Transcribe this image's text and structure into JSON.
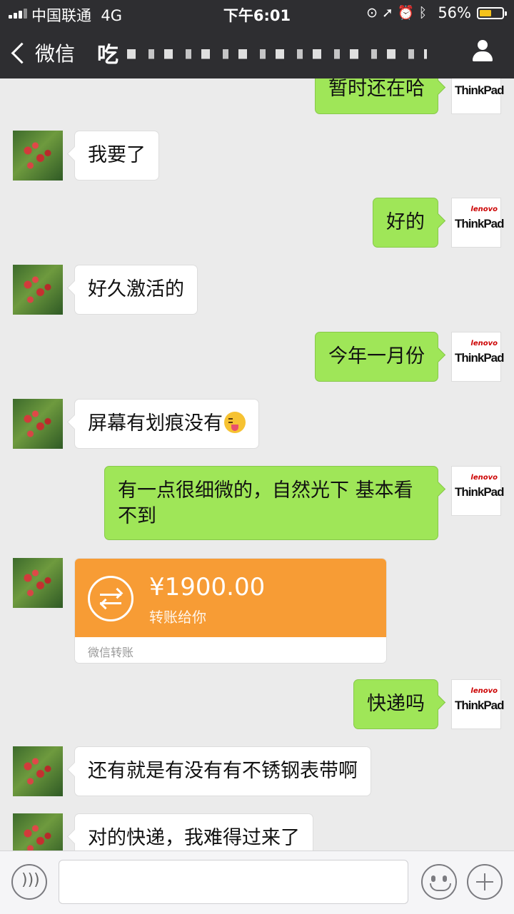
{
  "status_bar": {
    "carrier": "中国联通",
    "network": "4G",
    "time": "下午6:01",
    "battery_percent": "56%"
  },
  "nav": {
    "back_label": "微信",
    "title": "吃"
  },
  "messages": [
    {
      "side": "right",
      "text": "暂时还在哈"
    },
    {
      "side": "left",
      "text": "我要了"
    },
    {
      "side": "right",
      "text": "好的"
    },
    {
      "side": "left",
      "text": "好久激活的"
    },
    {
      "side": "right",
      "text": "今年一月份"
    },
    {
      "side": "left",
      "text": "屏幕有划痕没有",
      "emoji": "squinting-tongue-emoji"
    },
    {
      "side": "right",
      "text_line1": "有一点很细微的，自然光下 基本看",
      "text_line2": "不到"
    },
    {
      "side": "left",
      "type": "transfer",
      "amount": "¥1900.00",
      "desc": "转账给你",
      "label": "微信转账"
    },
    {
      "side": "right",
      "text": "快递吗"
    },
    {
      "side": "left",
      "text": "还有就是有没有有不锈钢表带啊"
    },
    {
      "side": "left",
      "text": "对的快递，我难得过来了"
    }
  ],
  "avatar_right": {
    "brand_small": "lenovo",
    "brand": "ThinkPad"
  },
  "input_bar": {
    "voice_icon": "voice-icon",
    "emoji_icon": "emoji-icon",
    "plus_icon": "plus-icon"
  }
}
